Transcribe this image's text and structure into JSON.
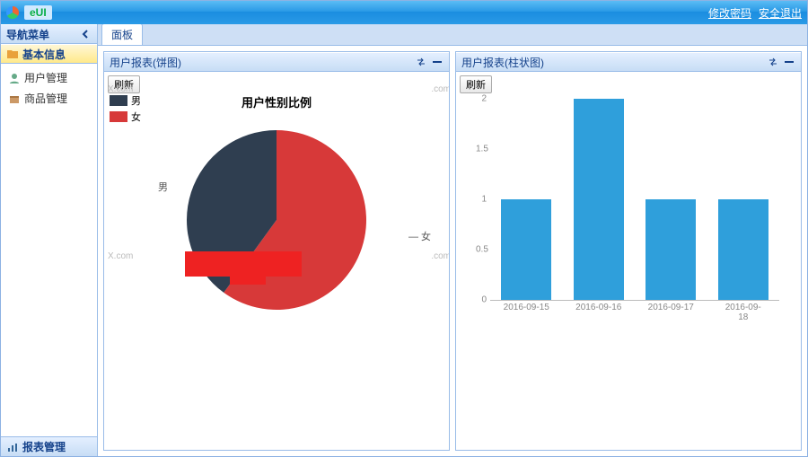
{
  "header": {
    "app_title": "eUI",
    "link_change_pw": "修改密码",
    "link_logout": "安全退出"
  },
  "west": {
    "title": "导航菜单",
    "acc1_title": "基本信息",
    "items": [
      {
        "label": "用户管理"
      },
      {
        "label": "商品管理"
      }
    ],
    "acc2_title": "报表管理"
  },
  "tabs": {
    "active_label": "面板"
  },
  "portlet_pie": {
    "title": "用户报表(饼图)",
    "refresh_label": "刷新"
  },
  "portlet_bar": {
    "title": "用户报表(柱状图)",
    "refresh_label": "刷新"
  },
  "colors": {
    "male": "#2f3e50",
    "female": "#d73939",
    "bar": "#2f9fdb"
  },
  "chart_data": [
    {
      "type": "pie",
      "title": "用户性别比例",
      "series": [
        {
          "name": "男",
          "value": 40
        },
        {
          "name": "女",
          "value": 60
        }
      ],
      "legend": [
        "男",
        "女"
      ]
    },
    {
      "type": "bar",
      "categories": [
        "2016-09-15",
        "2016-09-16",
        "2016-09-17",
        "2016-09-18"
      ],
      "values": [
        1,
        2,
        1,
        1
      ],
      "ylim": [
        0,
        2
      ],
      "yticks": [
        0,
        0.5,
        1,
        1.5,
        2
      ]
    }
  ],
  "watermarks": [
    "X.com",
    "X.com",
    ".com",
    ".com"
  ]
}
